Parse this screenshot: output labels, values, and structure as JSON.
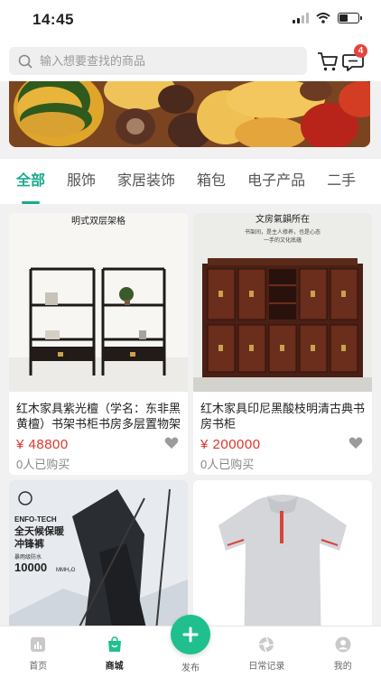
{
  "status_bar": {
    "time": "14:45",
    "battery_level": 0.45
  },
  "search": {
    "placeholder": "输入想要查找的商品"
  },
  "header": {
    "message_badge": "4"
  },
  "colors": {
    "accent": "#1aa98e",
    "price": "#e0342f",
    "publish": "#1fc08e",
    "badge": "#e64340"
  },
  "tabs": [
    {
      "label": "全部",
      "active": true
    },
    {
      "label": "服饰"
    },
    {
      "label": "家居装饰"
    },
    {
      "label": "箱包"
    },
    {
      "label": "电子产品"
    },
    {
      "label": "二手"
    }
  ],
  "products": [
    {
      "title": "红木家具紫光檀（学名：东非黑黄檀）书架书柜书房多层置物架",
      "price": "¥ 48800",
      "sold": "0人已购买",
      "image_caption": "明式双层架格"
    },
    {
      "title": "红木家具印尼黑酸枝明清古典书房书柜",
      "price": "¥ 200000",
      "sold": "0人已购买",
      "image_caption": "文房氣韻所在",
      "image_subcaption_1": "书架间，是主人修养，也是心态",
      "image_subcaption_2": "一手的文化底蕴"
    },
    {
      "title": "",
      "price": "",
      "sold": "",
      "image_brand": "ENFO-TECH",
      "image_line_1": "全天候保暖",
      "image_line_2": "冲锋裤",
      "image_line_3": "暴雨级防水",
      "image_line_4": "10000",
      "image_line_4_unit": "MMH₂O"
    },
    {
      "title": "",
      "price": "",
      "sold": ""
    }
  ],
  "bottom_nav": {
    "items": [
      {
        "label": "首页",
        "icon": "home-chart-icon"
      },
      {
        "label": "商城",
        "icon": "shop-bag-icon",
        "active": true
      },
      {
        "label": "发布",
        "icon": "plus-icon"
      },
      {
        "label": "日常记录",
        "icon": "aperture-icon"
      },
      {
        "label": "我的",
        "icon": "user-icon"
      }
    ]
  }
}
